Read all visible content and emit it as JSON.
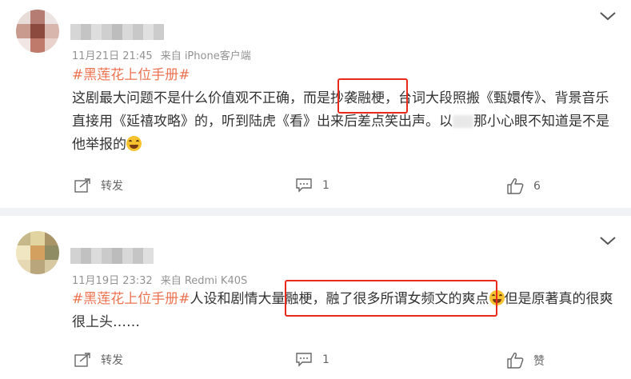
{
  "posts": [
    {
      "time": "11月21日 21:45",
      "source": "来自 iPhone客户端",
      "hashtag": "#黑莲花上位手册#",
      "text_before": "这剧最大问题不是什么价值观不正确，而是",
      "text_highlight": "抄袭融梗，",
      "text_after": "台词大段照搬《甄嬛传》、背景音乐直接用《延禧攻略》的，听到陆虎《看》出来后差点笑出声。以",
      "text_after_blur": "那小心眼不知道是不是他举报的",
      "emoji": "grinning-sweat-emoji",
      "repost_label": "转发",
      "comment_count": "1",
      "like_count": "6"
    },
    {
      "time": "11月19日 23:32",
      "source": "来自 Redmi K40S",
      "hashtag": "#黑莲花上位手册#",
      "text_before": "人设和剧情大量",
      "text_highlight": "融梗，融了很多所谓女频文的爽点",
      "text_after": "但是原著真的很爽很上头……",
      "emoji": "laughing-tears-emoji",
      "repost_label": "转发",
      "comment_count": "1",
      "like_count": "赞"
    }
  ],
  "colors": {
    "tag": "#eb7350",
    "highlight_box": "#e8291c",
    "separator": "#f1f2f5"
  },
  "icons": [
    "chevron-down-icon",
    "repost-icon",
    "comment-icon",
    "like-icon"
  ]
}
